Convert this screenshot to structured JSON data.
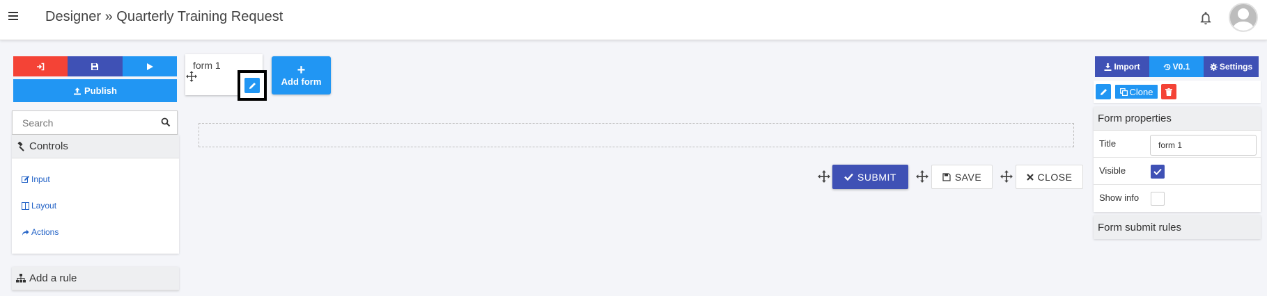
{
  "header": {
    "title": "Designer » Quarterly Training Request",
    "menu_icon": "hamburger-icon",
    "notification_icon": "bell-icon",
    "avatar_icon": "user-avatar"
  },
  "left_panel": {
    "toolbar": [
      {
        "icon": "exit-icon",
        "color": "#f44336"
      },
      {
        "icon": "save-icon",
        "color": "#3f51b5"
      },
      {
        "icon": "play-icon",
        "color": "#2196f3"
      }
    ],
    "publish_label": "Publish",
    "search_placeholder": "Search",
    "controls_title": "Controls",
    "controls": [
      {
        "label": "Input",
        "icon": "edit-icon"
      },
      {
        "label": "Layout",
        "icon": "columns-icon"
      },
      {
        "label": "Actions",
        "icon": "share-icon"
      }
    ],
    "add_rule_label": "Add a rule"
  },
  "canvas": {
    "form_tab_label": "form 1",
    "add_form_label": "Add form",
    "buttons": {
      "submit": "SUBMIT",
      "save": "SAVE",
      "close": "CLOSE"
    }
  },
  "right_panel": {
    "import_label": "Import",
    "version_label": "V0.1",
    "settings_label": "Settings",
    "clone_label": "Clone",
    "form_properties_title": "Form properties",
    "properties": {
      "title_label": "Title",
      "title_value": "form 1",
      "visible_label": "Visible",
      "visible_checked": true,
      "show_info_label": "Show info",
      "show_info_checked": false
    },
    "submit_rules_title": "Form submit rules"
  },
  "colors": {
    "primary": "#3f51b5",
    "accent": "#2196f3",
    "danger": "#f44336",
    "background": "#f4f5f9"
  }
}
